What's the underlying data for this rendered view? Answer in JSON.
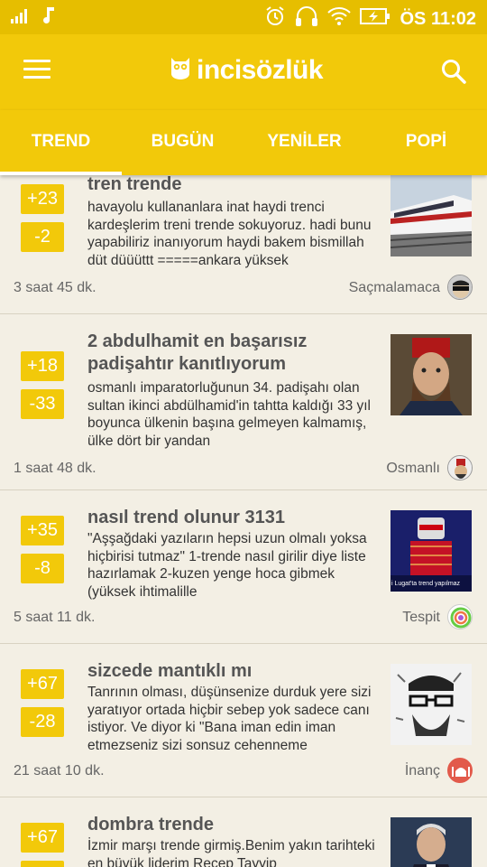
{
  "status_bar": {
    "carrier_icon": "signal-bars-icon",
    "music_icon": "music-note-icon",
    "time": "ÖS 11:02"
  },
  "app": {
    "logo_text": "incisözlük",
    "brand_color": "#f2c90a"
  },
  "tabs": [
    {
      "label": "TREND",
      "active": true
    },
    {
      "label": "BUGÜN",
      "active": false
    },
    {
      "label": "YENİLER",
      "active": false
    },
    {
      "label": "POPİ",
      "active": false
    }
  ],
  "posts": [
    {
      "up": "+23",
      "down": "-2",
      "title": "tren trende",
      "excerpt": "havayolu kullananlara inat haydi trenci kardeşlerim treni trende sokuyoruz. hadi bunu yapabiliriz inanıyorum haydi bakem bismillah düt düüüttt =====ankara yüksek",
      "time": "3 saat 45 dk.",
      "author": "Saçmalamaca",
      "thumb_icon": "train-photo",
      "avatar_icon": "sunglasses-avatar"
    },
    {
      "up": "+18",
      "down": "-33",
      "title": "2 abdulhamit en başarısız padişahtır kanıtlıyorum",
      "excerpt": "osmanlı imparatorluğunun 34. padişahı olan sultan ikinci abdülhamid'in tahtta kaldığı 33 yıl boyunca ülkenin başına gelmeyen kalmamış, ülke dört bir yandan",
      "time": "1 saat 48 dk.",
      "author": "Osmanlı",
      "thumb_icon": "sultan-portrait-photo",
      "avatar_icon": "fez-avatar"
    },
    {
      "up": "+35",
      "down": "-8",
      "title": "nasıl trend olunur 3131",
      "excerpt": "\"Aşşağdaki yazıların hepsi uzun olmalı yoksa hiçbirisi tutmaz\" 1-trende nasıl girilir diye liste hazırlamak 2-kuzen yenge hoca gibmek (yüksek ihtimalille",
      "time": "5 saat 11 dk.",
      "author": "Tespit",
      "thumb_icon": "robot-stage-photo",
      "thumb_caption": "i Lugat'ta trend yapılmaz",
      "avatar_icon": "rainbow-ring-avatar"
    },
    {
      "up": "+67",
      "down": "-28",
      "title": "sizcede mantıklı mı",
      "excerpt": "Tanrının olması, düşünsenize durduk yere sizi yaratıyor ortada hiçbir sebep yok sadece canı istiyor. Ve diyor ki \"Bana iman edin iman etmezseniz sizi sonsuz cehenneme",
      "time": "21 saat 10 dk.",
      "author": "İnanç",
      "thumb_icon": "bearded-man-sketch",
      "avatar_icon": "mosque-avatar"
    },
    {
      "up": "+67",
      "down": "",
      "title": "dombra trende",
      "excerpt": "İzmir marşı trende girmiş.Benim yakın tarihteki en büyük liderim Recep Tayyip",
      "time": "",
      "author": "",
      "thumb_icon": "politician-photo",
      "avatar_icon": ""
    }
  ]
}
